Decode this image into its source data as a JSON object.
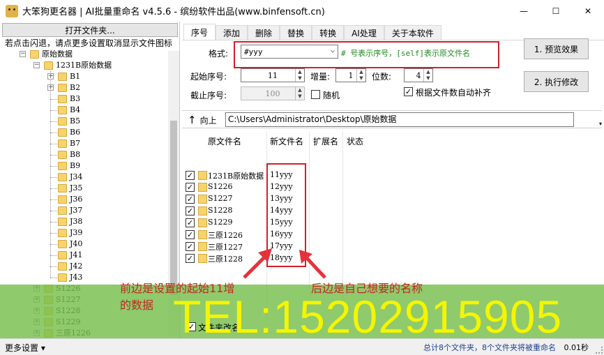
{
  "window": {
    "title": "大笨狗更名器 | AI批量重命名 v4.5.6 - 缤纷软件出品(www.binfensoft.cn)",
    "min_glyph": "—",
    "max_glyph": "☐",
    "close_glyph": "✕"
  },
  "left": {
    "open_folder_label": "打开文件夹...",
    "hint": "若点击闪退，请点更多设置取消显示文件图标",
    "tree": {
      "root": "原始数据",
      "child": "1231B原始数据",
      "leaves": [
        "B1",
        "B2",
        "B3",
        "B4",
        "B5",
        "B6",
        "B7",
        "B8",
        "B9",
        "J34",
        "J35",
        "J36",
        "J37",
        "J38",
        "J39",
        "J40",
        "J41",
        "J42",
        "J43"
      ],
      "siblings": [
        "S1226",
        "S1227",
        "S1228",
        "S1229",
        "三原1226"
      ]
    }
  },
  "tabs": [
    "序号",
    "添加",
    "删除",
    "替换",
    "转换",
    "AI处理",
    "关于本软件"
  ],
  "serial": {
    "format_label": "格式:",
    "format_value": "#yyy",
    "format_hint": "# 号表示序号，[self]表示原文件名",
    "start_label": "起始序号:",
    "start_value": "11",
    "increment_label": "增量:",
    "increment_value": "1",
    "digits_label": "位数:",
    "digits_value": "4",
    "end_label": "截止序号:",
    "end_value": "100",
    "random_label": "随机",
    "auto_pad_label": "根据文件数自动补齐"
  },
  "buttons": {
    "preview": "1. 预览效果",
    "execute": "2. 执行修改"
  },
  "path": {
    "up_label": "向上",
    "value": "C:\\Users\\Administrator\\Desktop\\原始数据"
  },
  "file_list": {
    "columns": [
      "原文件名",
      "新文件名",
      "扩展名",
      "状态"
    ],
    "rows": [
      {
        "orig": "1231B原始数据",
        "new": "11yyy"
      },
      {
        "orig": "S1226",
        "new": "12yyy"
      },
      {
        "orig": "S1227",
        "new": "13yyy"
      },
      {
        "orig": "S1228",
        "new": "14yyy"
      },
      {
        "orig": "S1229",
        "new": "15yyy"
      },
      {
        "orig": "三原1226",
        "new": "16yyy"
      },
      {
        "orig": "三原1227",
        "new": "17yyy"
      },
      {
        "orig": "三原1228",
        "new": "18yyy"
      }
    ]
  },
  "annotations": {
    "left_line1": "前边是设置的起始11增",
    "left_line2": "的数据",
    "right": "后边是自己想要的名称",
    "tel": "TEL:15202915905",
    "folder_rename_label": "文件夹改名"
  },
  "status": {
    "more_settings": "更多设置 ▾",
    "summary": "总计8个文件夹，8个文件夹将被重命名",
    "timing": "0.01秒"
  },
  "colors": {
    "annotation_red": "#d0202a",
    "overlay_green": "#76be4c",
    "tel_yellow": "#f5f500"
  }
}
